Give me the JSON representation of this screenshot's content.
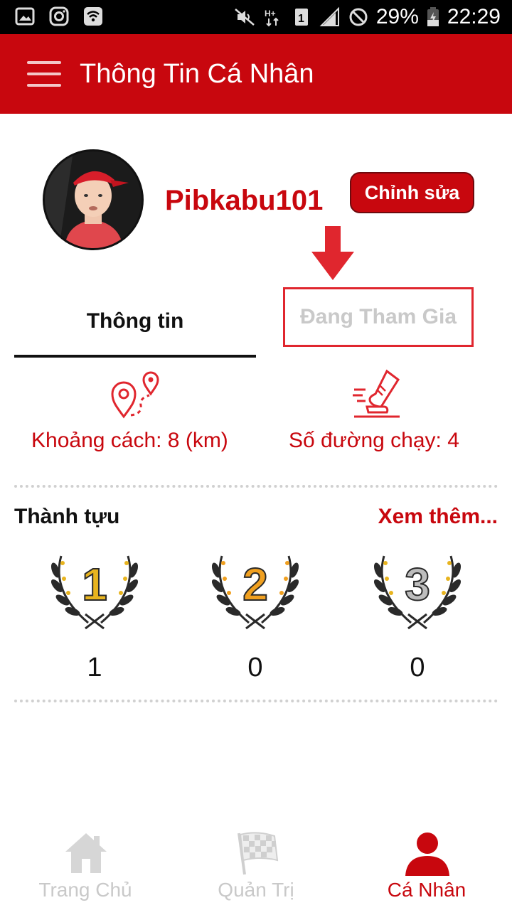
{
  "status_bar": {
    "battery": "29%",
    "time": "22:29",
    "left_icons": [
      "gallery-icon",
      "instagram-icon",
      "wifi-icon"
    ],
    "right_icons": [
      "mute-icon",
      "data-icon",
      "sim-icon",
      "signal-icon",
      "blocked-icon",
      "battery-icon"
    ]
  },
  "app_bar": {
    "title": "Thông Tin Cá Nhân"
  },
  "profile": {
    "username": "Pibkabu101",
    "edit_label": "Chỉnh sửa"
  },
  "tabs": [
    {
      "label": "Thông tin",
      "active": true
    },
    {
      "label": "Đang Tham Gia",
      "active": false
    }
  ],
  "stats": {
    "distance": "Khoảng cách: 8 (km)",
    "runs": "Số đường chạy: 4"
  },
  "achievements": {
    "title": "Thành tựu",
    "more_label": "Xem thêm...",
    "medals": [
      {
        "rank": "1",
        "count": "1",
        "color": "#e8b41f"
      },
      {
        "rank": "2",
        "count": "0",
        "color": "#f0a020"
      },
      {
        "rank": "3",
        "count": "0",
        "color": "#bdbdbd"
      }
    ]
  },
  "bottom_nav": [
    {
      "label": "Trang Chủ",
      "icon": "home-icon",
      "active": false
    },
    {
      "label": "Quản Trị",
      "icon": "checkered-flag-icon",
      "active": false
    },
    {
      "label": "Cá Nhân",
      "icon": "person-icon",
      "active": true
    }
  ],
  "colors": {
    "primary": "#c8070e",
    "inactive": "#c9c9c9",
    "highlight_box": "#e0262e"
  }
}
